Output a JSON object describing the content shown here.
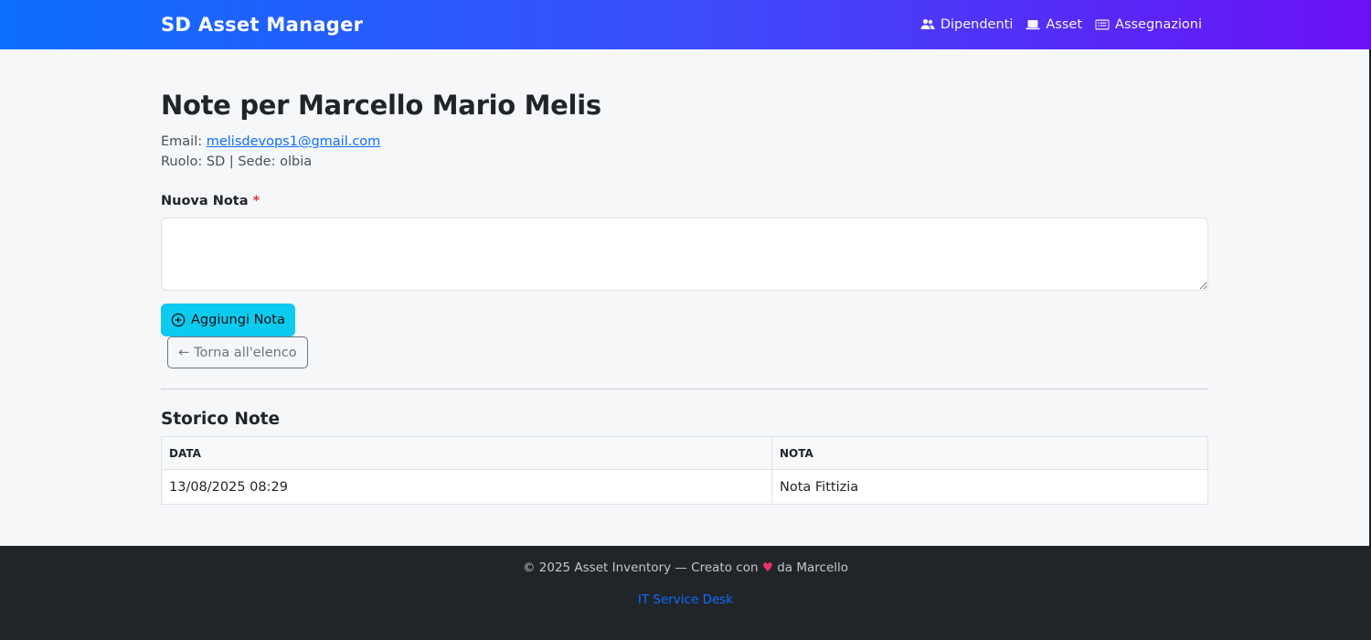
{
  "navbar": {
    "brand": "SD Asset Manager",
    "links": [
      {
        "label": "Dipendenti",
        "icon": "people-icon"
      },
      {
        "label": "Asset",
        "icon": "laptop-icon"
      },
      {
        "label": "Assegnazioni",
        "icon": "card-list-icon"
      }
    ]
  },
  "page": {
    "title": "Note per Marcello Mario Melis",
    "email_label": "Email: ",
    "email": "melisdevops1@gmail.com",
    "role_line": "Ruolo: SD | Sede: olbia"
  },
  "form": {
    "label": "Nuova Nota",
    "required_mark": "*",
    "textarea_value": "",
    "add_button": "Aggiungi Nota",
    "back_button": "Torna all'elenco"
  },
  "history": {
    "title": "Storico Note",
    "columns": [
      "Data",
      "Nota"
    ],
    "rows": [
      {
        "data": "13/08/2025 08:29",
        "nota": "Nota Fittizia"
      }
    ]
  },
  "footer": {
    "credit_prefix": "© 2025 Asset Inventory — Creato con",
    "credit_suffix": "da Marcello",
    "link": "IT Service Desk"
  },
  "colors": {
    "accent": "#0d6efd",
    "gradient_end": "#6a11f4",
    "add_button": "#0dcaf0",
    "footer_bg": "#212529"
  }
}
